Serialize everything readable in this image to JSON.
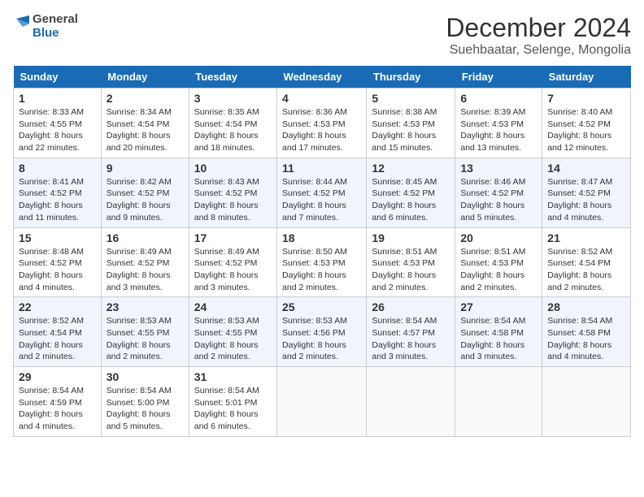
{
  "header": {
    "logo_general": "General",
    "logo_blue": "Blue",
    "month_title": "December 2024",
    "location": "Suehbaatar, Selenge, Mongolia"
  },
  "weekdays": [
    "Sunday",
    "Monday",
    "Tuesday",
    "Wednesday",
    "Thursday",
    "Friday",
    "Saturday"
  ],
  "weeks": [
    [
      {
        "day": "1",
        "sunrise": "8:33 AM",
        "sunset": "4:55 PM",
        "daylight": "8 hours and 22 minutes."
      },
      {
        "day": "2",
        "sunrise": "8:34 AM",
        "sunset": "4:54 PM",
        "daylight": "8 hours and 20 minutes."
      },
      {
        "day": "3",
        "sunrise": "8:35 AM",
        "sunset": "4:54 PM",
        "daylight": "8 hours and 18 minutes."
      },
      {
        "day": "4",
        "sunrise": "8:36 AM",
        "sunset": "4:53 PM",
        "daylight": "8 hours and 17 minutes."
      },
      {
        "day": "5",
        "sunrise": "8:38 AM",
        "sunset": "4:53 PM",
        "daylight": "8 hours and 15 minutes."
      },
      {
        "day": "6",
        "sunrise": "8:39 AM",
        "sunset": "4:53 PM",
        "daylight": "8 hours and 13 minutes."
      },
      {
        "day": "7",
        "sunrise": "8:40 AM",
        "sunset": "4:52 PM",
        "daylight": "8 hours and 12 minutes."
      }
    ],
    [
      {
        "day": "8",
        "sunrise": "8:41 AM",
        "sunset": "4:52 PM",
        "daylight": "8 hours and 11 minutes."
      },
      {
        "day": "9",
        "sunrise": "8:42 AM",
        "sunset": "4:52 PM",
        "daylight": "8 hours and 9 minutes."
      },
      {
        "day": "10",
        "sunrise": "8:43 AM",
        "sunset": "4:52 PM",
        "daylight": "8 hours and 8 minutes."
      },
      {
        "day": "11",
        "sunrise": "8:44 AM",
        "sunset": "4:52 PM",
        "daylight": "8 hours and 7 minutes."
      },
      {
        "day": "12",
        "sunrise": "8:45 AM",
        "sunset": "4:52 PM",
        "daylight": "8 hours and 6 minutes."
      },
      {
        "day": "13",
        "sunrise": "8:46 AM",
        "sunset": "4:52 PM",
        "daylight": "8 hours and 5 minutes."
      },
      {
        "day": "14",
        "sunrise": "8:47 AM",
        "sunset": "4:52 PM",
        "daylight": "8 hours and 4 minutes."
      }
    ],
    [
      {
        "day": "15",
        "sunrise": "8:48 AM",
        "sunset": "4:52 PM",
        "daylight": "8 hours and 4 minutes."
      },
      {
        "day": "16",
        "sunrise": "8:49 AM",
        "sunset": "4:52 PM",
        "daylight": "8 hours and 3 minutes."
      },
      {
        "day": "17",
        "sunrise": "8:49 AM",
        "sunset": "4:52 PM",
        "daylight": "8 hours and 3 minutes."
      },
      {
        "day": "18",
        "sunrise": "8:50 AM",
        "sunset": "4:53 PM",
        "daylight": "8 hours and 2 minutes."
      },
      {
        "day": "19",
        "sunrise": "8:51 AM",
        "sunset": "4:53 PM",
        "daylight": "8 hours and 2 minutes."
      },
      {
        "day": "20",
        "sunrise": "8:51 AM",
        "sunset": "4:53 PM",
        "daylight": "8 hours and 2 minutes."
      },
      {
        "day": "21",
        "sunrise": "8:52 AM",
        "sunset": "4:54 PM",
        "daylight": "8 hours and 2 minutes."
      }
    ],
    [
      {
        "day": "22",
        "sunrise": "8:52 AM",
        "sunset": "4:54 PM",
        "daylight": "8 hours and 2 minutes."
      },
      {
        "day": "23",
        "sunrise": "8:53 AM",
        "sunset": "4:55 PM",
        "daylight": "8 hours and 2 minutes."
      },
      {
        "day": "24",
        "sunrise": "8:53 AM",
        "sunset": "4:55 PM",
        "daylight": "8 hours and 2 minutes."
      },
      {
        "day": "25",
        "sunrise": "8:53 AM",
        "sunset": "4:56 PM",
        "daylight": "8 hours and 2 minutes."
      },
      {
        "day": "26",
        "sunrise": "8:54 AM",
        "sunset": "4:57 PM",
        "daylight": "8 hours and 3 minutes."
      },
      {
        "day": "27",
        "sunrise": "8:54 AM",
        "sunset": "4:58 PM",
        "daylight": "8 hours and 3 minutes."
      },
      {
        "day": "28",
        "sunrise": "8:54 AM",
        "sunset": "4:58 PM",
        "daylight": "8 hours and 4 minutes."
      }
    ],
    [
      {
        "day": "29",
        "sunrise": "8:54 AM",
        "sunset": "4:59 PM",
        "daylight": "8 hours and 4 minutes."
      },
      {
        "day": "30",
        "sunrise": "8:54 AM",
        "sunset": "5:00 PM",
        "daylight": "8 hours and 5 minutes."
      },
      {
        "day": "31",
        "sunrise": "8:54 AM",
        "sunset": "5:01 PM",
        "daylight": "8 hours and 6 minutes."
      },
      null,
      null,
      null,
      null
    ]
  ]
}
